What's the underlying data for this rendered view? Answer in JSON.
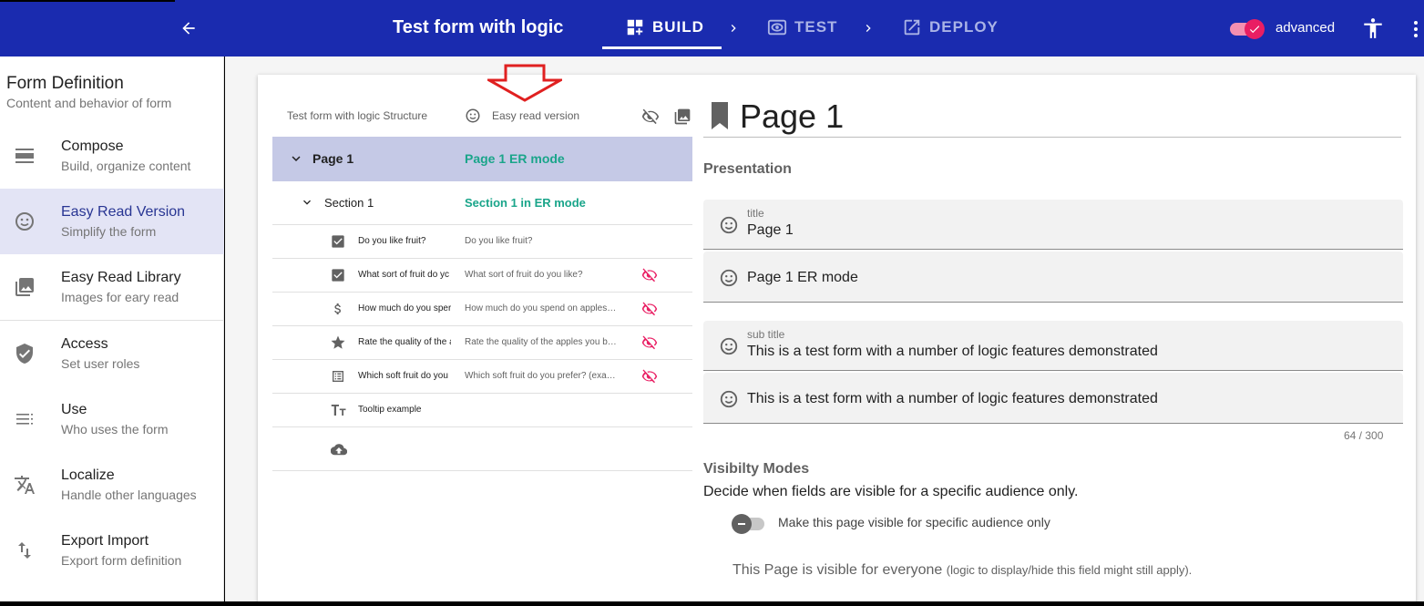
{
  "header": {
    "title": "Test form with logic",
    "steps": [
      {
        "label": "BUILD",
        "icon": "build-icon",
        "active": true
      },
      {
        "label": "TEST",
        "icon": "eye-test-icon",
        "active": false
      },
      {
        "label": "DEPLOY",
        "icon": "open-in-new-icon",
        "active": false
      }
    ],
    "advanced_label": "advanced",
    "advanced_on": true,
    "colors": {
      "bar": "#1a2baf",
      "accent": "#e91e63",
      "teal": "#1aa58a"
    }
  },
  "sidebar": {
    "title": "Form Definition",
    "subtitle": "Content and behavior of form",
    "items": [
      {
        "label": "Compose",
        "desc": "Build, organize content",
        "icon": "compose-icon"
      },
      {
        "label": "Easy Read Version",
        "desc": "Simplify the form",
        "icon": "smiley-icon",
        "active": true
      },
      {
        "label": "Easy Read Library",
        "desc": "Images for eary read",
        "icon": "image-library-icon"
      },
      {
        "label": "Access",
        "desc": "Set user roles",
        "icon": "shield-check-icon"
      },
      {
        "label": "Use",
        "desc": "Who uses the form",
        "icon": "list-icon"
      },
      {
        "label": "Localize",
        "desc": "Handle other languages",
        "icon": "translate-icon"
      },
      {
        "label": "Export Import",
        "desc": "Export form definition",
        "icon": "swap-vert-icon"
      }
    ]
  },
  "structure": {
    "header_left": "Test form with logic Structure",
    "header_right": "Easy read version",
    "page": {
      "label": "Page 1",
      "er": "Page 1 ER mode"
    },
    "section": {
      "label": "Section 1",
      "er": "Section 1 in ER mode"
    },
    "rows": [
      {
        "icon": "checkbox-icon",
        "label": "Do you like fruit?",
        "er": "Do you like fruit?",
        "hidden": false
      },
      {
        "icon": "checkbox-icon",
        "label": "What sort of fruit do yc",
        "er": "What sort of fruit do you like?",
        "hidden": true
      },
      {
        "icon": "dollar-icon",
        "label": "How much do you sper",
        "er": "How much do you spend on apples…",
        "hidden": true
      },
      {
        "icon": "star-icon",
        "label": "Rate the quality of the a",
        "er": "Rate the quality of the apples you b…",
        "hidden": true
      },
      {
        "icon": "table-icon",
        "label": "Which soft fruit do you",
        "er": "Which soft fruit do you prefer? (exa…",
        "hidden": true
      },
      {
        "icon": "text-icon",
        "label": "Tooltip example",
        "er": "",
        "hidden": false
      }
    ]
  },
  "detail": {
    "title": "Page 1",
    "presentation_label": "Presentation",
    "title_field": {
      "label": "title",
      "value": "Page 1"
    },
    "title_er_value": "Page 1 ER mode",
    "subtitle_field": {
      "label": "sub title",
      "value": "This is a test form with a number of logic features demonstrated"
    },
    "subtitle_er_value": "This is a test form with a number of logic features demonstrated",
    "counter": "64 / 300",
    "visibility": {
      "heading": "Visibilty Modes",
      "description": "Decide when fields are visible for a specific audience only.",
      "toggle_label": "Make this page visible for specific audience only",
      "toggle_on": false,
      "info_main": "This Page is visible for everyone",
      "info_note": "(logic to display/hide this field might still apply)."
    }
  }
}
